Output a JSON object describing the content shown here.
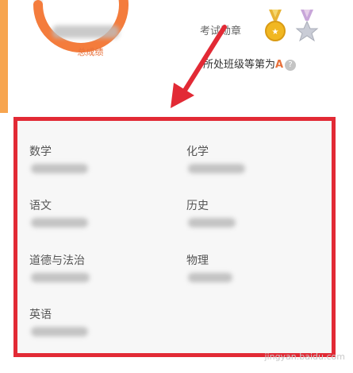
{
  "score_card": {
    "caption": "总成绩",
    "ring_color": "#f47c3c"
  },
  "medals": {
    "label": "考试勋章",
    "gold": "gold-medal",
    "silver": "silver-medal"
  },
  "rank": {
    "prefix": "所处班级等第为",
    "grade": "A",
    "help": "?"
  },
  "panel": {
    "border_color": "#e22a35",
    "subjects": [
      {
        "name": "数学"
      },
      {
        "name": "化学"
      },
      {
        "name": "语文"
      },
      {
        "name": "历史"
      },
      {
        "name": "道德与法治"
      },
      {
        "name": "物理"
      },
      {
        "name": "英语"
      }
    ]
  },
  "watermark": "jingyan.baidu.com"
}
